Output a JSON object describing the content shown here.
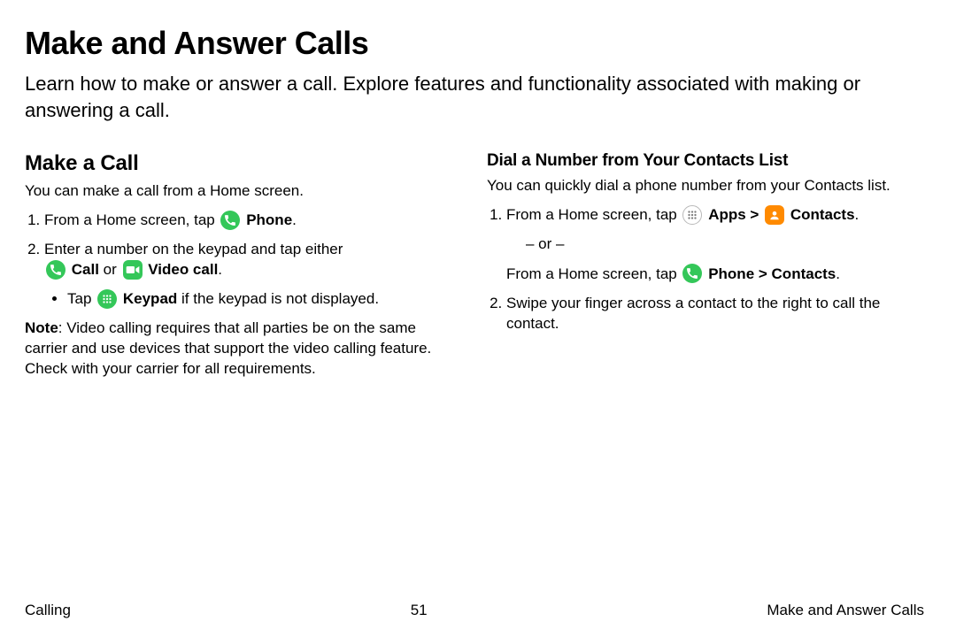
{
  "title": "Make and Answer Calls",
  "intro": "Learn how to make or answer a call. Explore features and functionality associated with making or answering a call.",
  "left": {
    "heading": "Make a Call",
    "lead": "You can make a call from a Home screen.",
    "step1_a": "From a Home screen, tap ",
    "step1_b": "Phone",
    "step1_c": ".",
    "step2_a": "Enter a number on the keypad and tap either ",
    "step2_call": "Call",
    "step2_or": " or ",
    "step2_video": "Video call",
    "step2_c": ".",
    "bullet_a": "Tap ",
    "bullet_b": "Keypad",
    "bullet_c": " if the keypad is not displayed.",
    "note_label": "Note",
    "note_body": ": Video calling requires that all parties be on the same carrier and use devices that support the video calling feature. Check with your carrier for all requirements."
  },
  "right": {
    "heading": "Dial a Number from Your Contacts List",
    "lead": "You can quickly dial a phone number from your Contacts list.",
    "step1_a": "From a Home screen, tap ",
    "step1_apps": "Apps",
    "step1_sep": " > ",
    "step1_contacts": "Contacts",
    "step1_c": ".",
    "or_text": "– or –",
    "alt_a": "From a Home screen, tap ",
    "alt_phone": "Phone",
    "alt_sep": " > ",
    "alt_contacts": "Contacts",
    "alt_c": ".",
    "step2": "Swipe your finger across a contact to the right to call the contact."
  },
  "footer": {
    "left": "Calling",
    "center": "51",
    "right": "Make and Answer Calls"
  }
}
